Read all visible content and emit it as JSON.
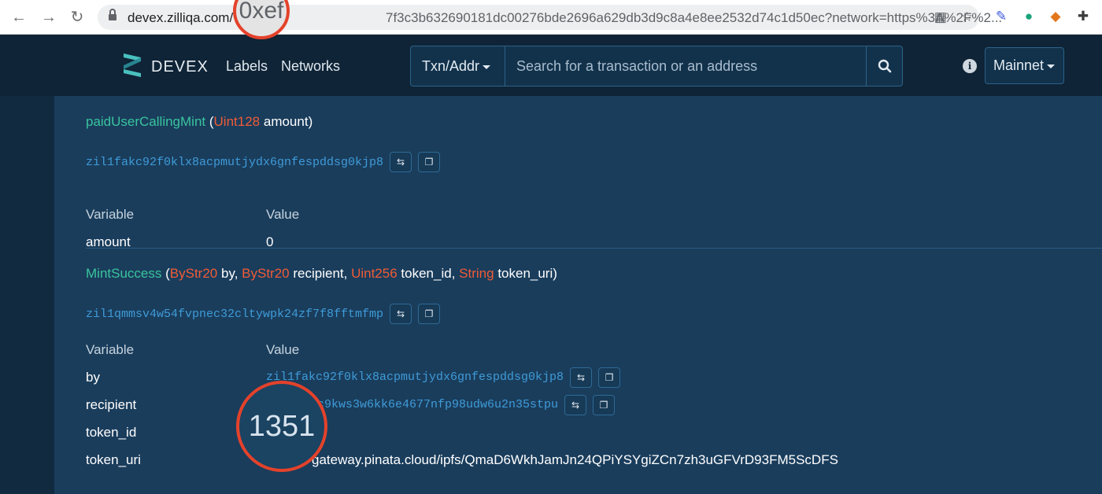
{
  "browser": {
    "url_host": "devex.zilliqa.com/",
    "url_zoom": "0xef",
    "url_rest": "7f3c3b632690181dc00276bde2696a629db3d9c8a4e8ee2532d74c1d50ec?network=https%3A%2F%2..."
  },
  "navbar": {
    "brand": "DEVEX",
    "links": [
      "Labels",
      "Networks"
    ],
    "search_type": "Txn/Addr",
    "search_placeholder": "Search for a transaction or an address",
    "network": "Mainnet"
  },
  "events": [
    {
      "name": "paidUserCallingMint",
      "params": [
        {
          "type": "Uint128",
          "name": "amount"
        }
      ],
      "address": "zil1fakc92f0klx8acpmutjydx6gnfespddsg0kjp8",
      "table_header": {
        "variable": "Variable",
        "value": "Value"
      },
      "rows": [
        {
          "variable": "amount",
          "value": "0"
        }
      ]
    },
    {
      "name": "MintSuccess",
      "params": [
        {
          "type": "ByStr20",
          "name": "by"
        },
        {
          "type": "ByStr20",
          "name": "recipient"
        },
        {
          "type": "Uint256",
          "name": "token_id"
        },
        {
          "type": "String",
          "name": "token_uri"
        }
      ],
      "address": "zil1qmmsv4w54fvpnec32cltywpk24zf7f8fftmfmp",
      "table_header": {
        "variable": "Variable",
        "value": "Value"
      },
      "rows": [
        {
          "variable": "by",
          "value": "zil1fakc92f0klx8acpmutjydx6gnfespddsg0kjp8"
        },
        {
          "variable": "recipient",
          "value": "pc9kws3w6kk6e4677nfp98udw6u2n35stpu"
        },
        {
          "variable": "token_id",
          "value": ""
        },
        {
          "variable": "token_uri",
          "value": "gateway.pinata.cloud/ipfs/QmaD6WkhJamJn24QPiYSYgiZCn7zh3uGFVrD93FM5ScDFS"
        }
      ]
    }
  ],
  "zoom_token_id": "1351",
  "colors": {
    "event_name": "#39c49e",
    "param_type": "#f15b37",
    "address": "#3f9bd8",
    "highlight_ring": "#e4422b"
  }
}
